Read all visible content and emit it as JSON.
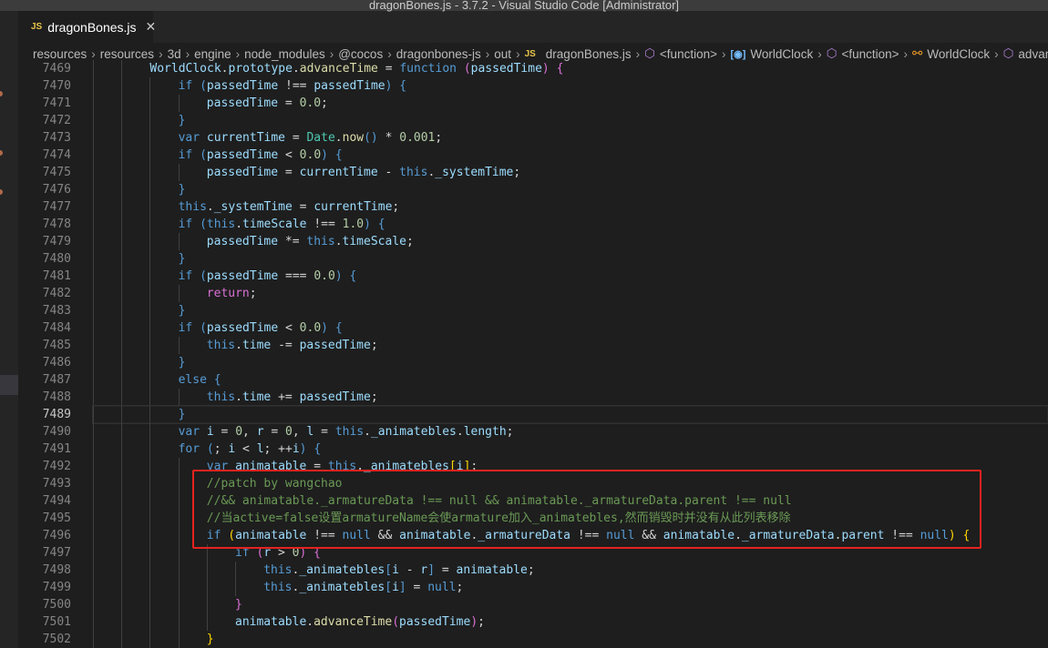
{
  "window": {
    "title": "dragonBones.js - 3.7.2 - Visual Studio Code [Administrator]"
  },
  "tab": {
    "label": "dragonBones.js",
    "icon": "JS",
    "close": "✕"
  },
  "breadcrumb": [
    "resources",
    "resources",
    "3d",
    "engine",
    "node_modules",
    "@cocos",
    "dragonbones-js",
    "out",
    "dragonBones.js",
    "<function>",
    "WorldClock",
    "<function>",
    "WorldClock",
    "advanceTime"
  ],
  "current_line": 7489,
  "lines": [
    {
      "n": 7469,
      "i": 8,
      "t": [
        [
          "v",
          "WorldClock"
        ],
        [
          "p",
          "."
        ],
        [
          "v",
          "prototype"
        ],
        [
          "p",
          "."
        ],
        [
          "f",
          "advanceTime"
        ],
        [
          "p",
          " = "
        ],
        [
          "k",
          "function"
        ],
        [
          "p",
          " "
        ],
        [
          "m",
          "("
        ],
        [
          "v",
          "passedTime"
        ],
        [
          "m",
          ")"
        ],
        [
          "p",
          " "
        ],
        [
          "m",
          "{"
        ]
      ]
    },
    {
      "n": 7470,
      "i": 12,
      "t": [
        [
          "k",
          "if"
        ],
        [
          "p",
          " "
        ],
        [
          "k",
          "("
        ],
        [
          "v",
          "passedTime"
        ],
        [
          "p",
          " !== "
        ],
        [
          "v",
          "passedTime"
        ],
        [
          "k",
          ")"
        ],
        [
          "p",
          " "
        ],
        [
          "k",
          "{"
        ]
      ]
    },
    {
      "n": 7471,
      "i": 16,
      "t": [
        [
          "v",
          "passedTime"
        ],
        [
          "p",
          " = "
        ],
        [
          "n",
          "0.0"
        ],
        [
          "p",
          ";"
        ]
      ]
    },
    {
      "n": 7472,
      "i": 12,
      "t": [
        [
          "k",
          "}"
        ]
      ]
    },
    {
      "n": 7473,
      "i": 12,
      "t": [
        [
          "k",
          "var"
        ],
        [
          "p",
          " "
        ],
        [
          "v",
          "currentTime"
        ],
        [
          "p",
          " = "
        ],
        [
          "t",
          "Date"
        ],
        [
          "p",
          "."
        ],
        [
          "f",
          "now"
        ],
        [
          "k",
          "()"
        ],
        [
          "p",
          " * "
        ],
        [
          "n",
          "0.001"
        ],
        [
          "p",
          ";"
        ]
      ]
    },
    {
      "n": 7474,
      "i": 12,
      "t": [
        [
          "k",
          "if"
        ],
        [
          "p",
          " "
        ],
        [
          "k",
          "("
        ],
        [
          "v",
          "passedTime"
        ],
        [
          "p",
          " < "
        ],
        [
          "n",
          "0.0"
        ],
        [
          "k",
          ")"
        ],
        [
          "p",
          " "
        ],
        [
          "k",
          "{"
        ]
      ]
    },
    {
      "n": 7475,
      "i": 16,
      "t": [
        [
          "v",
          "passedTime"
        ],
        [
          "p",
          " = "
        ],
        [
          "v",
          "currentTime"
        ],
        [
          "p",
          " - "
        ],
        [
          "k",
          "this"
        ],
        [
          "p",
          "."
        ],
        [
          "v",
          "_systemTime"
        ],
        [
          "p",
          ";"
        ]
      ]
    },
    {
      "n": 7476,
      "i": 12,
      "t": [
        [
          "k",
          "}"
        ]
      ]
    },
    {
      "n": 7477,
      "i": 12,
      "t": [
        [
          "k",
          "this"
        ],
        [
          "p",
          "."
        ],
        [
          "v",
          "_systemTime"
        ],
        [
          "p",
          " = "
        ],
        [
          "v",
          "currentTime"
        ],
        [
          "p",
          ";"
        ]
      ]
    },
    {
      "n": 7478,
      "i": 12,
      "t": [
        [
          "k",
          "if"
        ],
        [
          "p",
          " "
        ],
        [
          "k",
          "("
        ],
        [
          "k",
          "this"
        ],
        [
          "p",
          "."
        ],
        [
          "v",
          "timeScale"
        ],
        [
          "p",
          " !== "
        ],
        [
          "n",
          "1.0"
        ],
        [
          "k",
          ")"
        ],
        [
          "p",
          " "
        ],
        [
          "k",
          "{"
        ]
      ]
    },
    {
      "n": 7479,
      "i": 16,
      "t": [
        [
          "v",
          "passedTime"
        ],
        [
          "p",
          " *= "
        ],
        [
          "k",
          "this"
        ],
        [
          "p",
          "."
        ],
        [
          "v",
          "timeScale"
        ],
        [
          "p",
          ";"
        ]
      ]
    },
    {
      "n": 7480,
      "i": 12,
      "t": [
        [
          "k",
          "}"
        ]
      ]
    },
    {
      "n": 7481,
      "i": 12,
      "t": [
        [
          "k",
          "if"
        ],
        [
          "p",
          " "
        ],
        [
          "k",
          "("
        ],
        [
          "v",
          "passedTime"
        ],
        [
          "p",
          " === "
        ],
        [
          "n",
          "0.0"
        ],
        [
          "k",
          ")"
        ],
        [
          "p",
          " "
        ],
        [
          "k",
          "{"
        ]
      ]
    },
    {
      "n": 7482,
      "i": 16,
      "t": [
        [
          "m",
          "return"
        ],
        [
          "p",
          ";"
        ]
      ]
    },
    {
      "n": 7483,
      "i": 12,
      "t": [
        [
          "k",
          "}"
        ]
      ]
    },
    {
      "n": 7484,
      "i": 12,
      "t": [
        [
          "k",
          "if"
        ],
        [
          "p",
          " "
        ],
        [
          "k",
          "("
        ],
        [
          "v",
          "passedTime"
        ],
        [
          "p",
          " < "
        ],
        [
          "n",
          "0.0"
        ],
        [
          "k",
          ")"
        ],
        [
          "p",
          " "
        ],
        [
          "k",
          "{"
        ]
      ]
    },
    {
      "n": 7485,
      "i": 16,
      "t": [
        [
          "k",
          "this"
        ],
        [
          "p",
          "."
        ],
        [
          "v",
          "time"
        ],
        [
          "p",
          " -= "
        ],
        [
          "v",
          "passedTime"
        ],
        [
          "p",
          ";"
        ]
      ]
    },
    {
      "n": 7486,
      "i": 12,
      "t": [
        [
          "k",
          "}"
        ]
      ]
    },
    {
      "n": 7487,
      "i": 12,
      "t": [
        [
          "k",
          "else"
        ],
        [
          "p",
          " "
        ],
        [
          "k",
          "{"
        ]
      ]
    },
    {
      "n": 7488,
      "i": 16,
      "t": [
        [
          "k",
          "this"
        ],
        [
          "p",
          "."
        ],
        [
          "v",
          "time"
        ],
        [
          "p",
          " += "
        ],
        [
          "v",
          "passedTime"
        ],
        [
          "p",
          ";"
        ]
      ]
    },
    {
      "n": 7489,
      "i": 12,
      "t": [
        [
          "k",
          "}"
        ]
      ]
    },
    {
      "n": 7490,
      "i": 12,
      "t": [
        [
          "k",
          "var"
        ],
        [
          "p",
          " "
        ],
        [
          "v",
          "i"
        ],
        [
          "p",
          " = "
        ],
        [
          "n",
          "0"
        ],
        [
          "p",
          ", "
        ],
        [
          "v",
          "r"
        ],
        [
          "p",
          " = "
        ],
        [
          "n",
          "0"
        ],
        [
          "p",
          ", "
        ],
        [
          "v",
          "l"
        ],
        [
          "p",
          " = "
        ],
        [
          "k",
          "this"
        ],
        [
          "p",
          "."
        ],
        [
          "v",
          "_animatebles"
        ],
        [
          "p",
          "."
        ],
        [
          "v",
          "length"
        ],
        [
          "p",
          ";"
        ]
      ]
    },
    {
      "n": 7491,
      "i": 12,
      "t": [
        [
          "k",
          "for"
        ],
        [
          "p",
          " "
        ],
        [
          "k",
          "("
        ],
        [
          "p",
          "; "
        ],
        [
          "v",
          "i"
        ],
        [
          "p",
          " < "
        ],
        [
          "v",
          "l"
        ],
        [
          "p",
          "; ++"
        ],
        [
          "v",
          "i"
        ],
        [
          "k",
          ")"
        ],
        [
          "p",
          " "
        ],
        [
          "k",
          "{"
        ]
      ]
    },
    {
      "n": 7492,
      "i": 16,
      "t": [
        [
          "k",
          "var"
        ],
        [
          "p",
          " "
        ],
        [
          "v",
          "animatable"
        ],
        [
          "p",
          " = "
        ],
        [
          "k",
          "this"
        ],
        [
          "p",
          "."
        ],
        [
          "v",
          "_animatebles"
        ],
        [
          "b",
          "["
        ],
        [
          "v",
          "i"
        ],
        [
          "b",
          "]"
        ],
        [
          "p",
          ";"
        ]
      ]
    },
    {
      "n": 7493,
      "i": 16,
      "t": [
        [
          "c",
          "//patch by wangchao"
        ]
      ]
    },
    {
      "n": 7494,
      "i": 16,
      "t": [
        [
          "c",
          "//&& animatable._armatureData !== null && animatable._armatureData.parent !== null"
        ]
      ]
    },
    {
      "n": 7495,
      "i": 16,
      "t": [
        [
          "c",
          "//当active=false设置armatureName会使armature加入_animatebles,然而销毁时并没有从此列表移除"
        ]
      ]
    },
    {
      "n": 7496,
      "i": 16,
      "t": [
        [
          "k",
          "if"
        ],
        [
          "p",
          " "
        ],
        [
          "b",
          "("
        ],
        [
          "v",
          "animatable"
        ],
        [
          "p",
          " !== "
        ],
        [
          "k",
          "null"
        ],
        [
          "p",
          " && "
        ],
        [
          "v",
          "animatable"
        ],
        [
          "p",
          "."
        ],
        [
          "v",
          "_armatureData"
        ],
        [
          "p",
          " !== "
        ],
        [
          "k",
          "null"
        ],
        [
          "p",
          " && "
        ],
        [
          "v",
          "animatable"
        ],
        [
          "p",
          "."
        ],
        [
          "v",
          "_armatureData"
        ],
        [
          "p",
          "."
        ],
        [
          "v",
          "parent"
        ],
        [
          "p",
          " !== "
        ],
        [
          "k",
          "null"
        ],
        [
          "b",
          ")"
        ],
        [
          "p",
          " "
        ],
        [
          "b",
          "{"
        ]
      ]
    },
    {
      "n": 7497,
      "i": 20,
      "t": [
        [
          "k",
          "if"
        ],
        [
          "p",
          " "
        ],
        [
          "m",
          "("
        ],
        [
          "v",
          "r"
        ],
        [
          "p",
          " > "
        ],
        [
          "n",
          "0"
        ],
        [
          "m",
          ")"
        ],
        [
          "p",
          " "
        ],
        [
          "m",
          "{"
        ]
      ]
    },
    {
      "n": 7498,
      "i": 24,
      "t": [
        [
          "k",
          "this"
        ],
        [
          "p",
          "."
        ],
        [
          "v",
          "_animatebles"
        ],
        [
          "k",
          "["
        ],
        [
          "v",
          "i"
        ],
        [
          "p",
          " - "
        ],
        [
          "v",
          "r"
        ],
        [
          "k",
          "]"
        ],
        [
          "p",
          " = "
        ],
        [
          "v",
          "animatable"
        ],
        [
          "p",
          ";"
        ]
      ]
    },
    {
      "n": 7499,
      "i": 24,
      "t": [
        [
          "k",
          "this"
        ],
        [
          "p",
          "."
        ],
        [
          "v",
          "_animatebles"
        ],
        [
          "k",
          "["
        ],
        [
          "v",
          "i"
        ],
        [
          "k",
          "]"
        ],
        [
          "p",
          " = "
        ],
        [
          "k",
          "null"
        ],
        [
          "p",
          ";"
        ]
      ]
    },
    {
      "n": 7500,
      "i": 20,
      "t": [
        [
          "m",
          "}"
        ]
      ]
    },
    {
      "n": 7501,
      "i": 20,
      "t": [
        [
          "v",
          "animatable"
        ],
        [
          "p",
          "."
        ],
        [
          "f",
          "advanceTime"
        ],
        [
          "m",
          "("
        ],
        [
          "v",
          "passedTime"
        ],
        [
          "m",
          ")"
        ],
        [
          "p",
          ";"
        ]
      ]
    },
    {
      "n": 7502,
      "i": 16,
      "t": [
        [
          "b",
          "}"
        ]
      ]
    }
  ]
}
